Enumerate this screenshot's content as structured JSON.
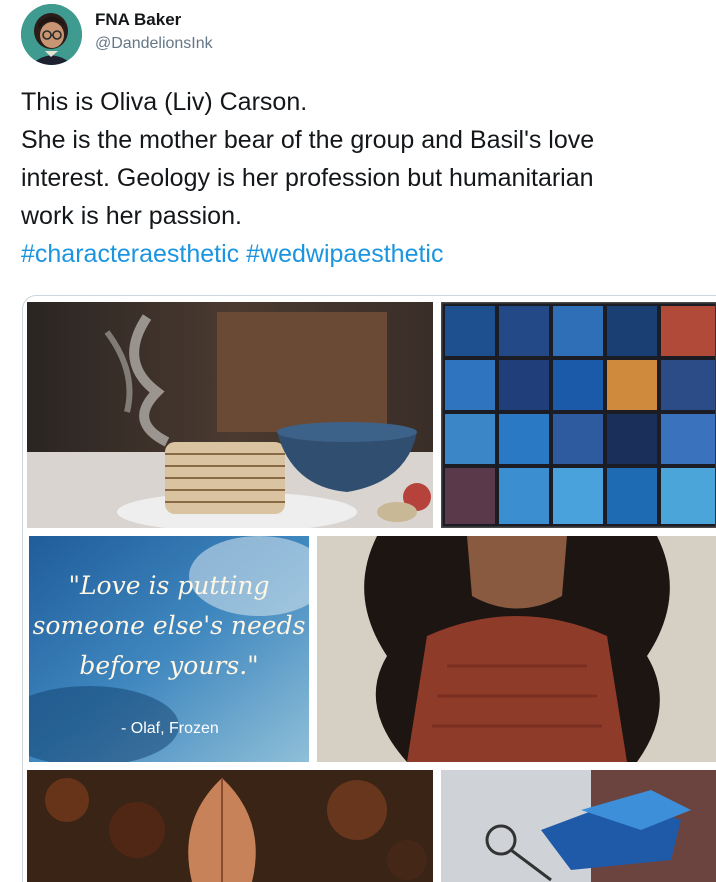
{
  "author": {
    "display_name": "FNA Baker",
    "handle": "@DandelionsInk"
  },
  "tweet": {
    "lines": [
      "This is Oliva (Liv) Carson.",
      "She is the mother bear of the group and Basil's love",
      "interest. Geology is her profession but humanitarian",
      "work is her passion."
    ],
    "hashtags": [
      "#characteraesthetic",
      "#wedwipaesthetic"
    ]
  },
  "media": {
    "quote_lines": [
      "\"Love is putting",
      "someone else's needs",
      "before yours.\""
    ],
    "quote_attribution": "- Olaf, Frozen"
  },
  "colors": {
    "link": "#1b95e0",
    "handle": "#657786",
    "text": "#14171a"
  }
}
